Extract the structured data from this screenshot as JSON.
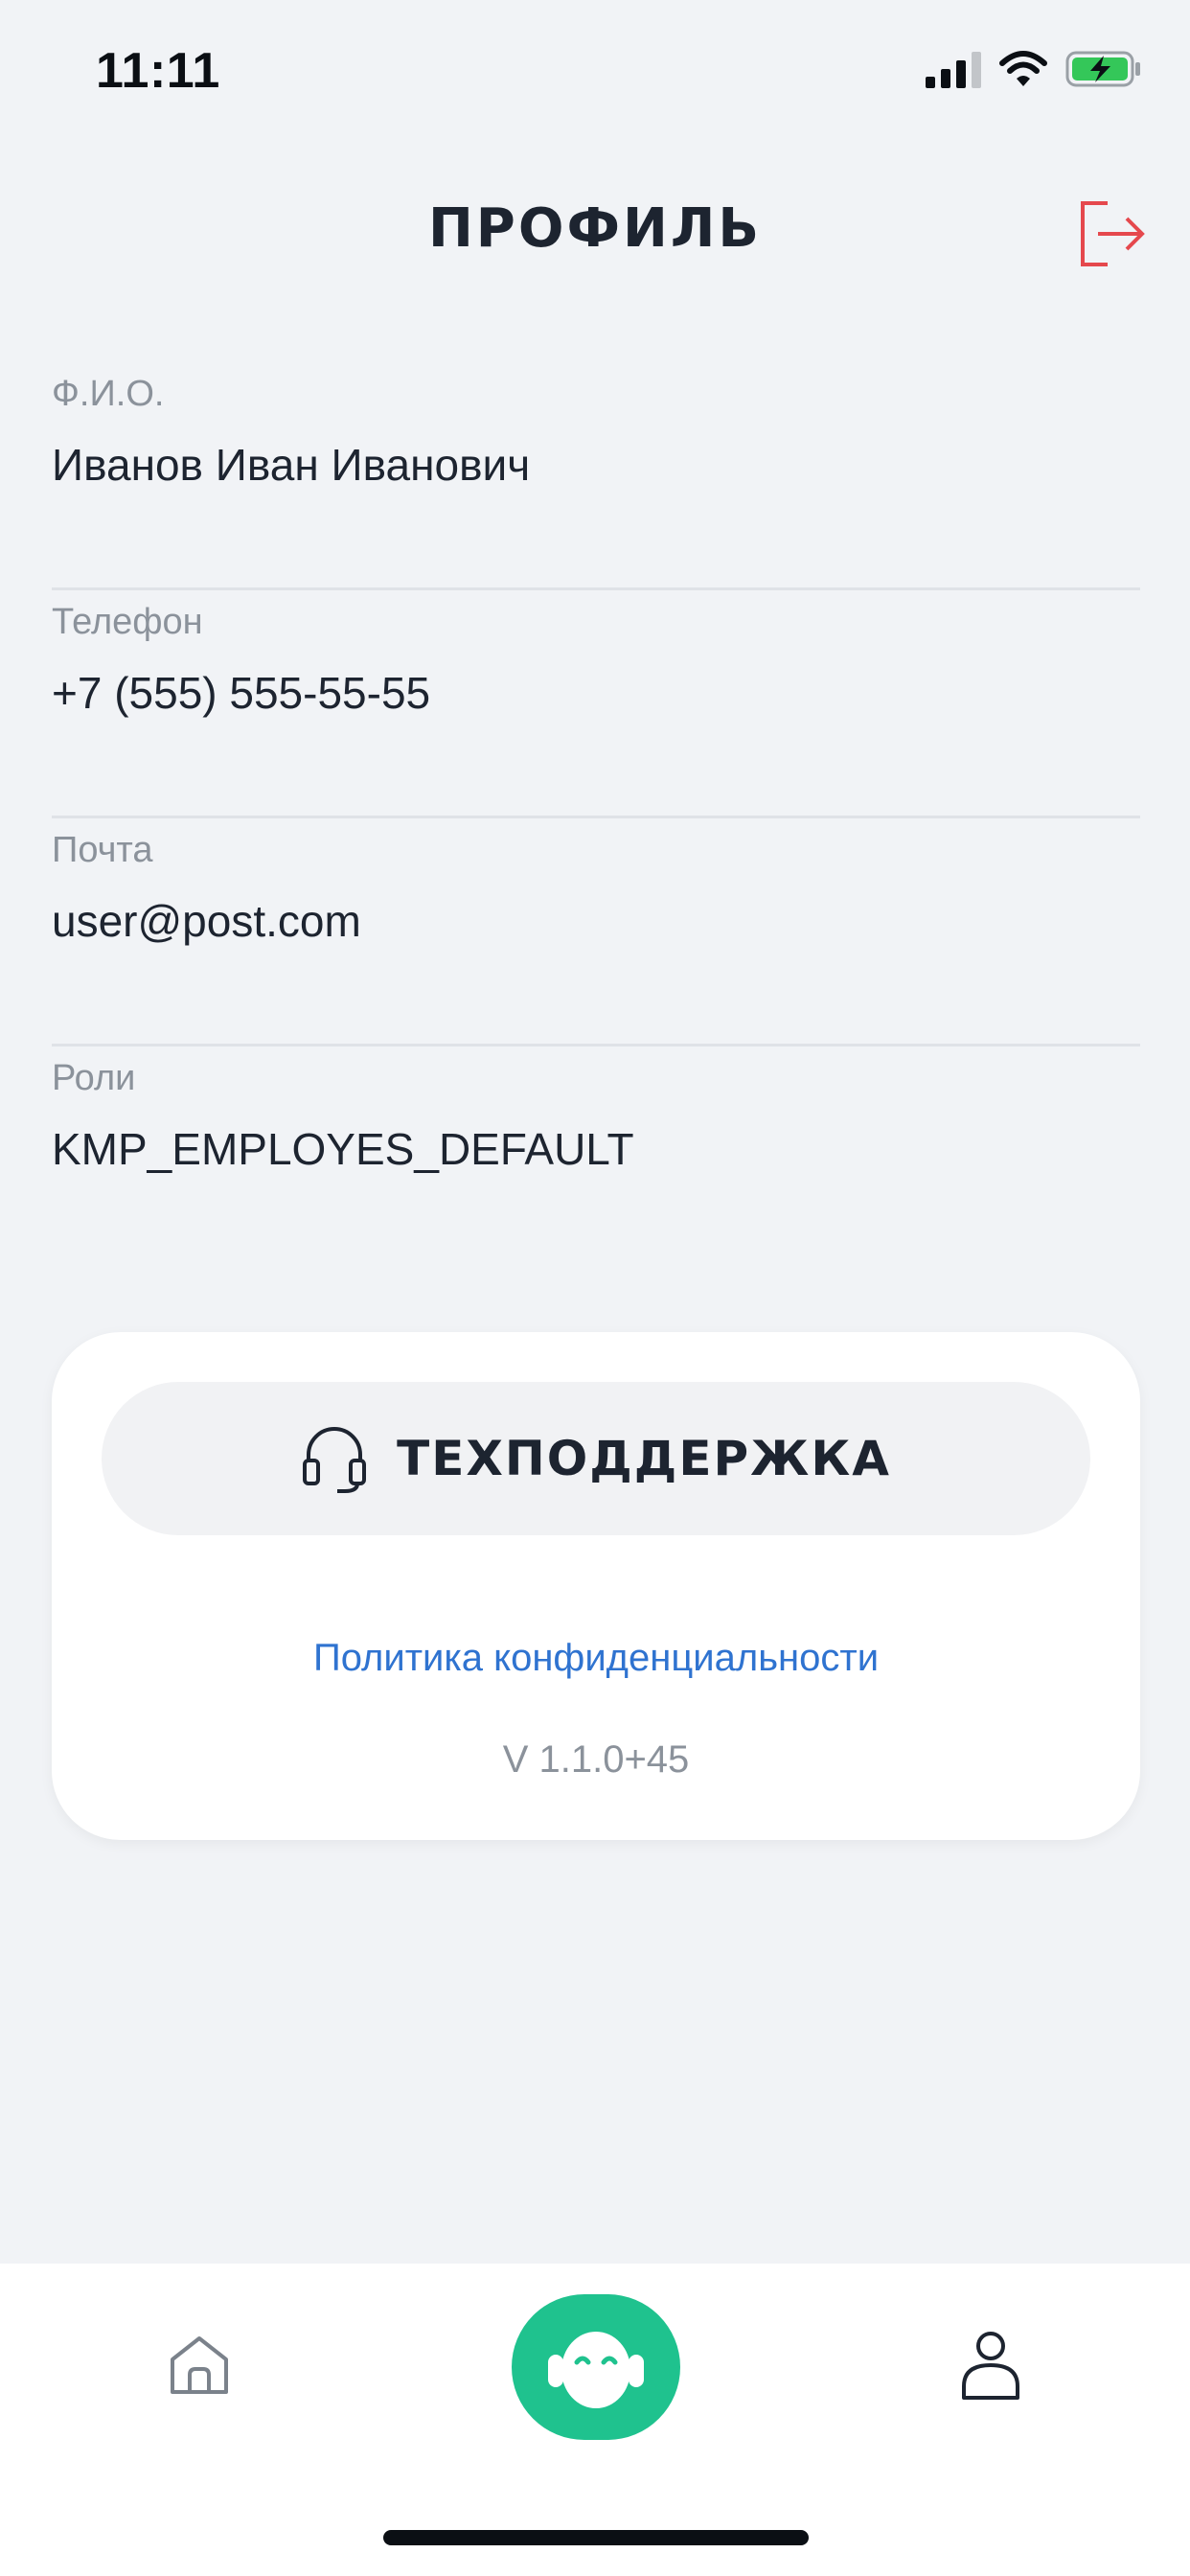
{
  "status_bar": {
    "time": "11:11"
  },
  "header": {
    "title": "ПРОФИЛЬ"
  },
  "fields": [
    {
      "label": "Ф.И.О.",
      "value": "Иванов Иван Иванович"
    },
    {
      "label": "Телефон",
      "value": "+7 (555) 555-55-55"
    },
    {
      "label": "Почта",
      "value": "user@post.com"
    },
    {
      "label": "Роли",
      "value": "KMP_EMPLOYES_DEFAULT"
    }
  ],
  "support_card": {
    "support_button_label": "ТЕХПОДДЕРЖКА",
    "privacy_link": "Политика конфиденциальности",
    "version": "V 1.1.0+45"
  },
  "colors": {
    "background": "#f1f3f6",
    "accent_green": "#1fc28e",
    "logout_red": "#e5484d",
    "link_blue": "#2f73d0"
  },
  "icons": {
    "logout": "logout-icon",
    "support": "headset-icon",
    "home": "home-icon",
    "assistant": "robot-assistant-icon",
    "profile": "user-icon"
  }
}
